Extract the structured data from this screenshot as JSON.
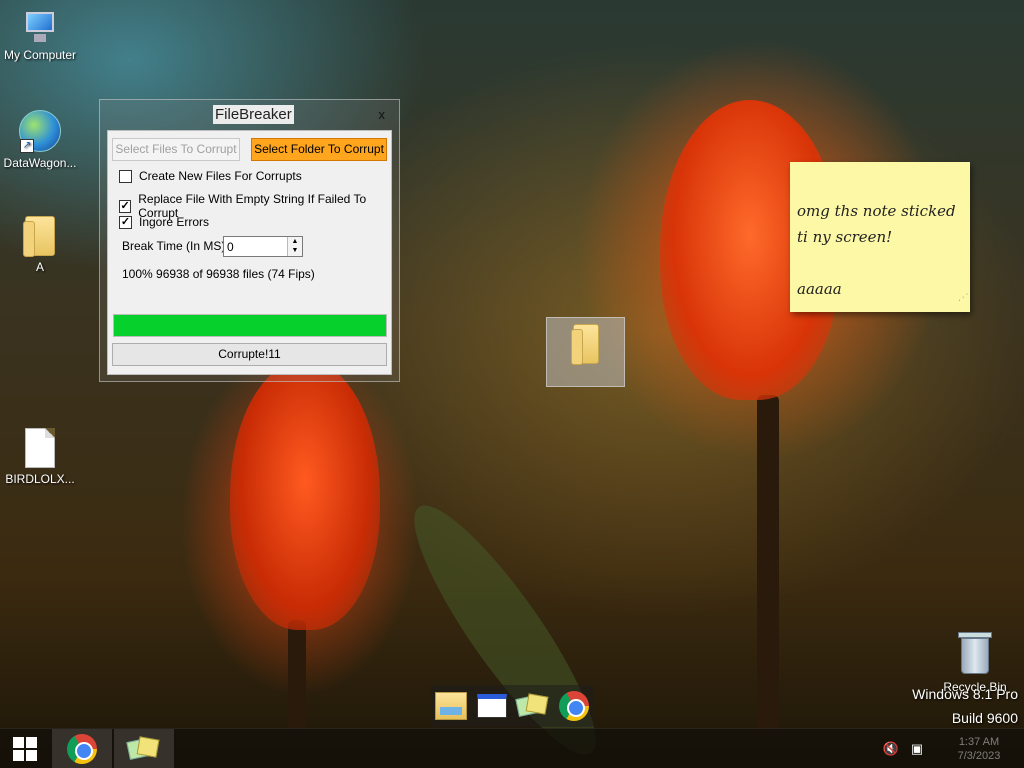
{
  "desktop": {
    "icons": [
      {
        "label": "My Computer"
      },
      {
        "label": "DataWagon..."
      },
      {
        "label": "A"
      },
      {
        "label": "BIRDLOLX..."
      },
      {
        "label": "Recycle Bin"
      }
    ]
  },
  "filebreaker": {
    "title": "FileBreaker",
    "close_label": "x",
    "select_files_label": "Select Files To Corrupt",
    "select_folder_label": "Select Folder To Corrupt",
    "option_create_new_label": "Create New Files For Corrupts",
    "option_create_new_checked": false,
    "option_replace_label": "Replace File With Empty String If Failed To Corrupt",
    "option_replace_checked": true,
    "option_ignore_label": "Ingore Errors",
    "option_ignore_checked": true,
    "break_time_label": "Break Time (In MS)",
    "break_time_value": "0",
    "status_text": "100% 96938 of 96938 files (74 Fips)",
    "progress_fraction": 1.0,
    "progress_color": "#06d02b",
    "corrupt_button_label": "Corrupte!11",
    "accent_color": "#ffa51e"
  },
  "sticky_note": {
    "lines": [
      "omg ths note sticked",
      "ti ny screen!",
      "",
      "aaaaa"
    ],
    "color": "#fdf8a6"
  },
  "watermark": {
    "line1": "Windows 8.1 Pro",
    "line2": "Build 9600"
  },
  "taskbar": {
    "start_icon": "windows-logo-icon",
    "pinned": [
      {
        "name": "chrome-icon"
      },
      {
        "name": "sticky-notes-icon"
      }
    ],
    "tray": {
      "volume_icon": "volume-muted-icon",
      "network_icon": "network-icon",
      "time": "1:37 AM",
      "date": "7/3/2023"
    }
  },
  "dock": {
    "items": [
      {
        "name": "file-explorer-icon"
      },
      {
        "name": "window-icon"
      },
      {
        "name": "sticky-notes-icon"
      },
      {
        "name": "chrome-icon"
      }
    ]
  }
}
